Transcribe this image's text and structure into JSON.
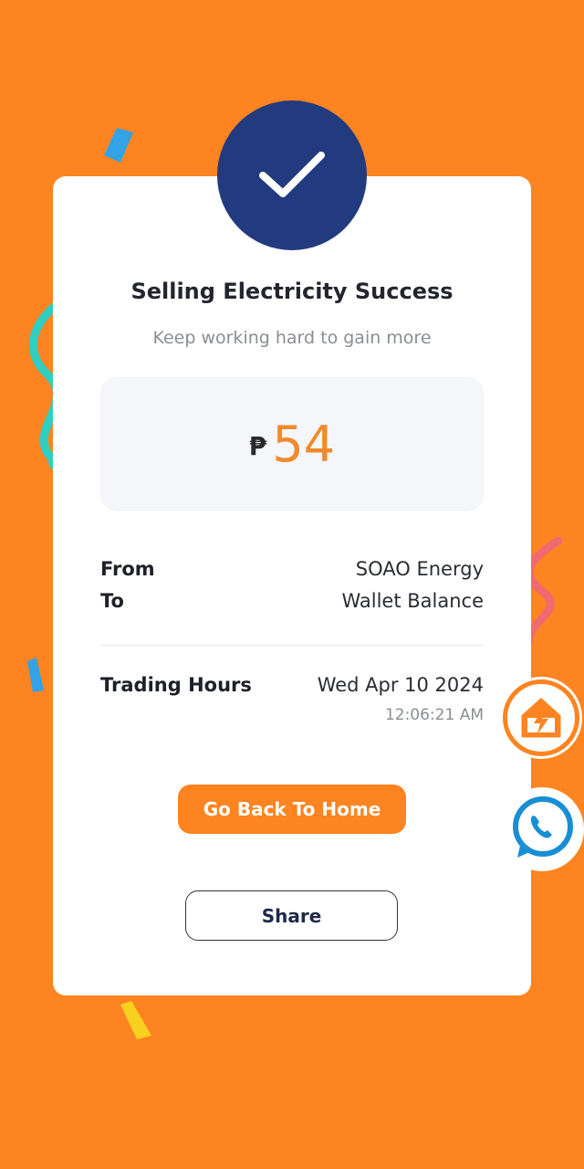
{
  "card": {
    "title": "Selling Electricity Success",
    "subtitle": "Keep working hard to gain more",
    "currency_symbol": "₱",
    "amount": "54",
    "details": {
      "from_label": "From",
      "from_value": "SOAO Energy",
      "to_label": "To",
      "to_value": "Wallet Balance",
      "trading_hours_label": "Trading Hours",
      "trading_date": "Wed Apr 10 2024",
      "trading_time": "12:06:21 AM"
    },
    "home_button_label": "Go Back To Home",
    "share_button_label": "Share"
  },
  "colors": {
    "background": "#fd8420",
    "check_circle": "#223a7e",
    "amount": "#f08a2c",
    "whatsapp": "#1a8ed4"
  },
  "floating": {
    "home_icon": "home-lightning-icon",
    "chat_icon": "whatsapp-icon"
  }
}
